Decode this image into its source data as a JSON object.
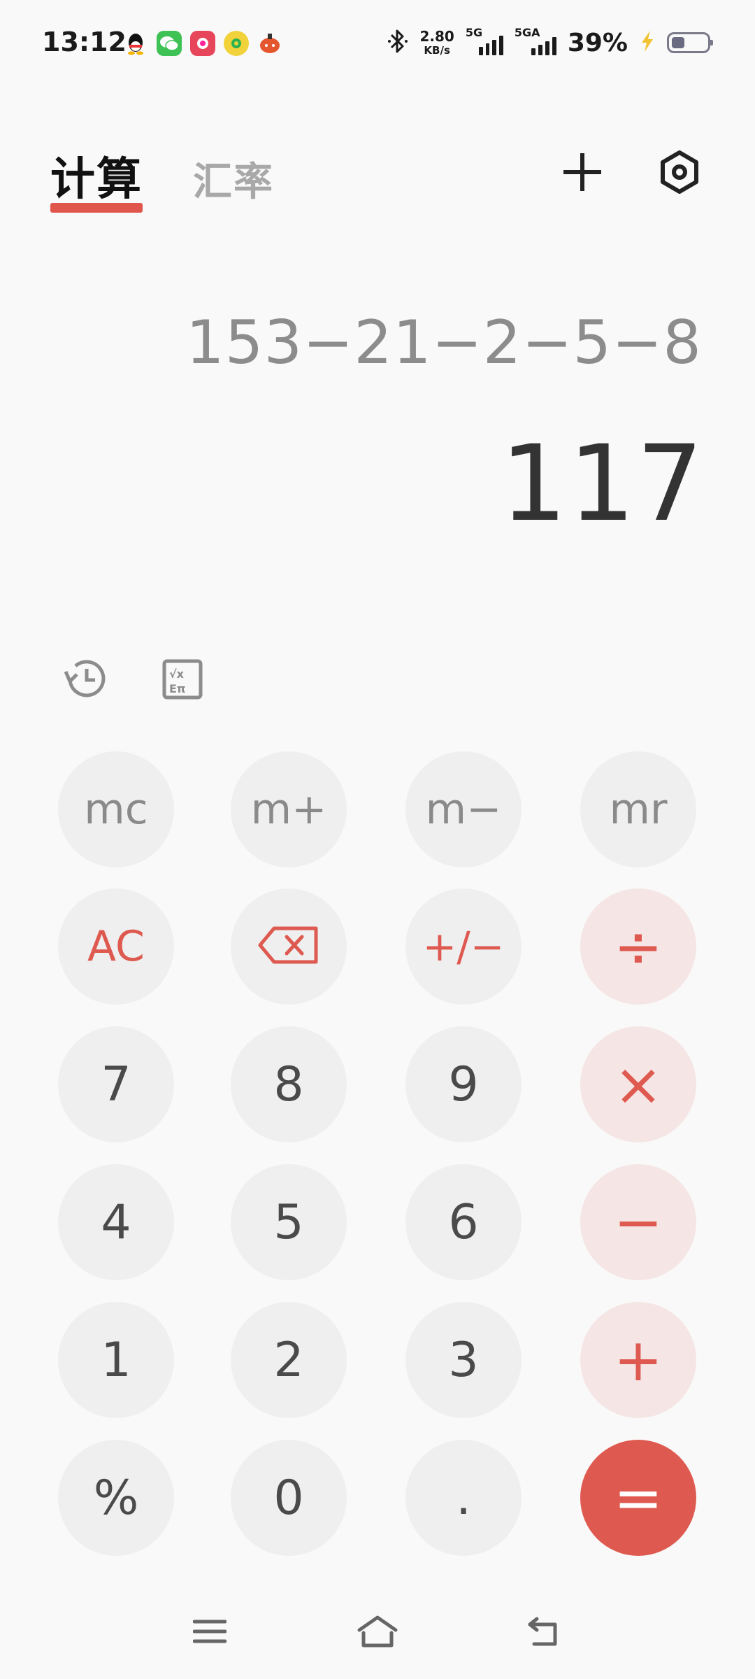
{
  "status_bar": {
    "time": "13:12",
    "net_speed_value": "2.80",
    "net_speed_unit": "KB/s",
    "sim1_label": "5G",
    "sim2_label": "5GA",
    "battery_percent": "39%",
    "battery_level": 0.39,
    "notification_icons": [
      "qq-icon",
      "wechat-icon",
      "app-icon",
      "music-icon",
      "game-icon"
    ]
  },
  "header": {
    "tab_calculate": "计算",
    "tab_exchange_rate": "汇率",
    "active_tab": "计算"
  },
  "display": {
    "expression": "153−21−2−5−8",
    "result": "117"
  },
  "keypad": {
    "mc": "mc",
    "m_plus": "m+",
    "m_minus": "m−",
    "mr": "mr",
    "ac": "AC",
    "plus_minus": "+/−",
    "divide": "÷",
    "multiply": "×",
    "minus": "−",
    "plus": "+",
    "equals": "=",
    "percent": "%",
    "decimal": ".",
    "d0": "0",
    "d1": "1",
    "d2": "2",
    "d3": "3",
    "d4": "4",
    "d5": "5",
    "d6": "6",
    "d7": "7",
    "d8": "8",
    "d9": "9"
  },
  "colors": {
    "accent": "#de5a50",
    "operator_bg": "#f5e6e5",
    "key_bg": "#efefef",
    "background": "#f9f9f9"
  }
}
